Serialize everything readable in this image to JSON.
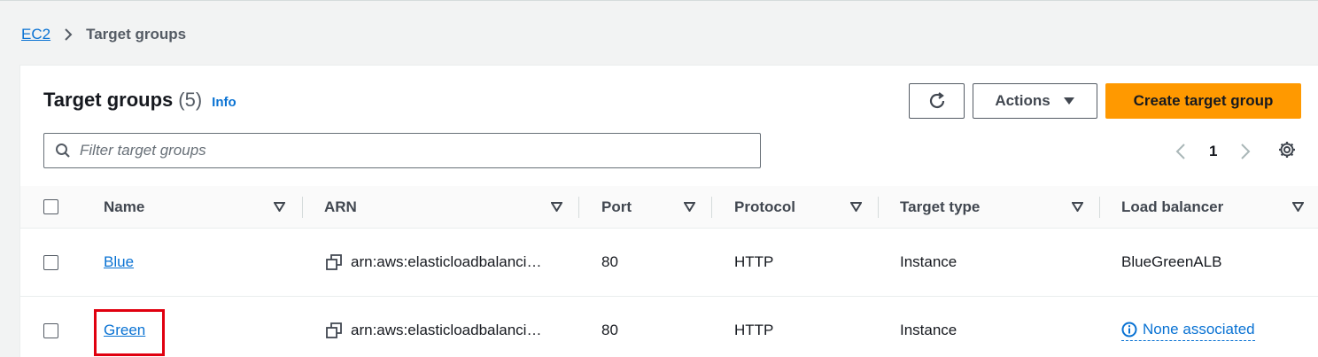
{
  "breadcrumb": {
    "root": "EC2",
    "current": "Target groups"
  },
  "header": {
    "title": "Target groups",
    "count": "(5)",
    "info": "Info",
    "actions_label": "Actions",
    "create_label": "Create target group"
  },
  "filter": {
    "placeholder": "Filter target groups"
  },
  "pagination": {
    "current_page": "1"
  },
  "table": {
    "columns": [
      "Name",
      "ARN",
      "Port",
      "Protocol",
      "Target type",
      "Load balancer"
    ],
    "rows": [
      {
        "name": "Blue",
        "arn": "arn:aws:elasticloadbalanci…",
        "port": "80",
        "protocol": "HTTP",
        "target_type": "Instance",
        "load_balancer": "BlueGreenALB"
      },
      {
        "name": "Green",
        "arn": "arn:aws:elasticloadbalanci…",
        "port": "80",
        "protocol": "HTTP",
        "target_type": "Instance",
        "load_balancer": "None associated"
      }
    ]
  },
  "colors": {
    "link": "#0972d3",
    "primary": "#ff9900",
    "highlight": "#e0000f"
  }
}
